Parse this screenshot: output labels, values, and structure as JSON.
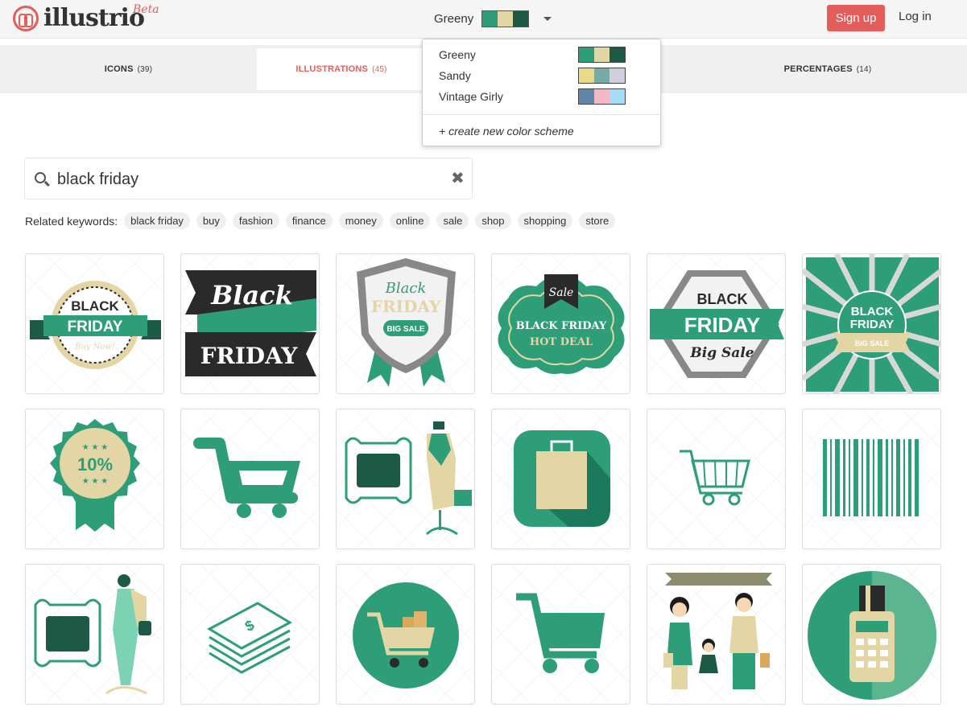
{
  "header": {
    "logo_text": "illustrio",
    "logo_beta": "Beta",
    "scheme_name": "Greeny",
    "signup_label": "Sign up",
    "login_label": "Log in"
  },
  "tabs": [
    {
      "label": "ICONS",
      "count": "(39)"
    },
    {
      "label": "ILLUSTRATIONS",
      "count": "(45)"
    },
    {
      "label": "PERCENTAGES",
      "count": "(14)"
    }
  ],
  "dropdown": {
    "items": [
      {
        "label": "Greeny",
        "colors": [
          "#2e9e79",
          "#e3d5a4",
          "#1c5a45"
        ]
      },
      {
        "label": "Sandy",
        "colors": [
          "#ead98a",
          "#78aaa8",
          "#cfd0dc"
        ]
      },
      {
        "label": "Vintage Girly",
        "colors": [
          "#5e86a8",
          "#f3b8c3",
          "#a6ddf6"
        ]
      }
    ],
    "create_label": "+ create new color scheme"
  },
  "search": {
    "value": "black friday",
    "clear_icon": "close-icon"
  },
  "related": {
    "label": "Related keywords:",
    "keywords": [
      "black friday",
      "buy",
      "fashion",
      "finance",
      "money",
      "online",
      "sale",
      "shop",
      "shopping",
      "store"
    ]
  },
  "cards": {
    "row1": [
      {
        "text1": "BLACK",
        "text2": "FRIDAY",
        "text3": "Buy Now!"
      },
      {
        "text1": "Black",
        "text2": "FRIDAY"
      },
      {
        "text1": "Black",
        "text2": "FRIDAY",
        "text3": "BIG SALE"
      },
      {
        "text1": "Sale",
        "text2": "BLACK FRIDAY",
        "text3": "HOT DEAL"
      },
      {
        "text1": "BLACK",
        "text2": "FRIDAY",
        "text3": "Big Sale"
      },
      {
        "text1": "BLACK",
        "text2": "FRIDAY",
        "text3": "BIG SALE"
      }
    ],
    "row2": [
      {
        "text1": "10%"
      }
    ]
  },
  "colors": {
    "accent": "#e35d5b",
    "green": "#2e9e79",
    "dark_green": "#1c5a45",
    "sand": "#e3d5a4",
    "dark": "#2a2a2a"
  }
}
